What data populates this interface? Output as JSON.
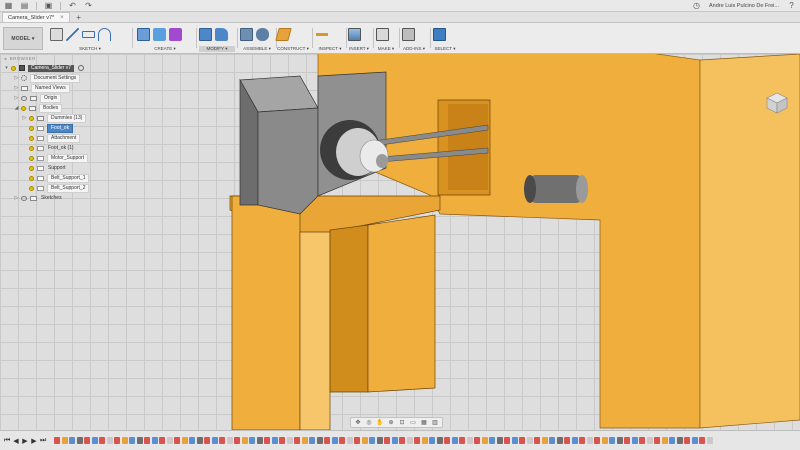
{
  "appbar": {
    "user_name": "Andre Luis Pulcino De Frei...",
    "icons": [
      "grid-icon",
      "file-icon",
      "save-icon",
      "undo-icon",
      "redo-icon",
      "clock-icon",
      "help-icon"
    ]
  },
  "document_tab": {
    "title": "Camera_Slider v7*",
    "close_glyph": "×",
    "add_glyph": "+"
  },
  "toolbar": {
    "workspace_label": "MODEL ▾",
    "groups": [
      {
        "label": "SKETCH ▾",
        "active": false
      },
      {
        "label": "CREATE ▾",
        "active": false
      },
      {
        "label": "MODIFY ▾",
        "active": true
      },
      {
        "label": "ASSEMBLE ▾",
        "active": false
      },
      {
        "label": "CONSTRUCT ▾",
        "active": false
      },
      {
        "label": "INSPECT ▾",
        "active": false
      },
      {
        "label": "INSERT ▾",
        "active": false
      },
      {
        "label": "MAKE ▾",
        "active": false
      },
      {
        "label": "ADD-INS ▾",
        "active": false
      },
      {
        "label": "SELECT ▾",
        "active": false
      }
    ]
  },
  "browser": {
    "header": "BROWSER",
    "root": "Camera_Slider v7",
    "items": [
      {
        "label": "Document Settings"
      },
      {
        "label": "Named Views"
      },
      {
        "label": "Origin"
      },
      {
        "label": "Bodies"
      },
      {
        "label": "Dummies (13)"
      },
      {
        "label": "Foot_ok"
      },
      {
        "label": "Attachment"
      },
      {
        "label": "Foot_ok (1)"
      },
      {
        "label": "Motor_Support"
      },
      {
        "label": "Support"
      },
      {
        "label": "Belt_Support_1"
      },
      {
        "label": "Belt_Support_2"
      },
      {
        "label": "Sketches"
      }
    ]
  },
  "colors": {
    "body_orange": "#f0ae3c",
    "body_orange_dark": "#c98a1f",
    "motor_grey": "#8a8a8a",
    "selection_blue": "#4b87c6"
  }
}
